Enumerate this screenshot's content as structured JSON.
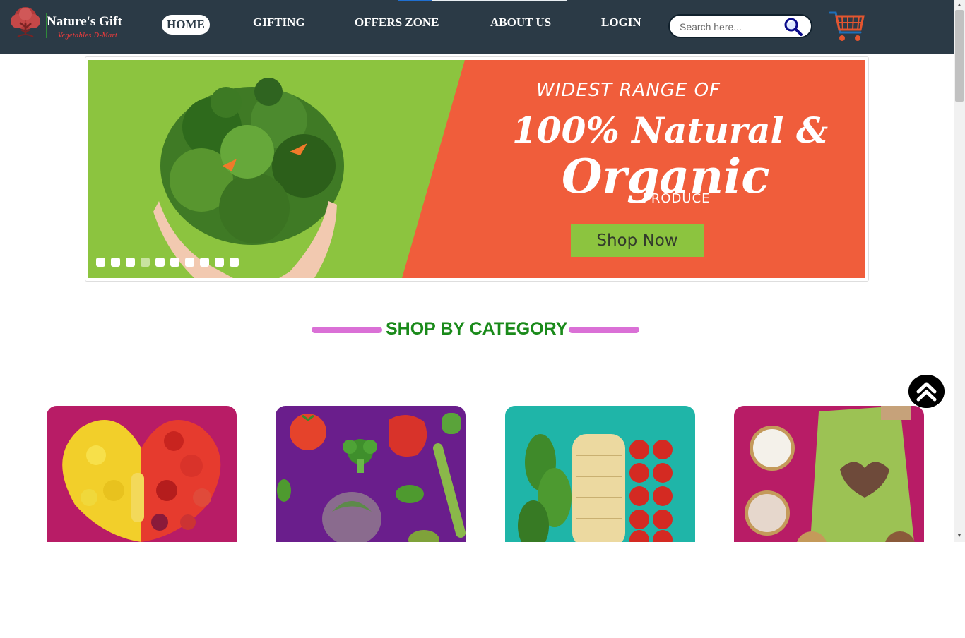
{
  "brand": {
    "name": "Nature's Gift",
    "tagline": "Vegetables D-Mart",
    "logo_icon": "tree-icon"
  },
  "nav": {
    "items": [
      {
        "label": "HOME",
        "active": true
      },
      {
        "label": "GIFTING",
        "active": false
      },
      {
        "label": "OFFERS ZONE",
        "active": false
      },
      {
        "label": "ABOUT US",
        "active": false
      },
      {
        "label": "LOGIN",
        "active": false
      }
    ]
  },
  "search": {
    "placeholder": "Search here...",
    "value": "",
    "icon": "magnifier-icon"
  },
  "cart": {
    "icon": "shopping-cart-icon"
  },
  "banner": {
    "line1": "WIDEST RANGE OF",
    "line2": "100% Natural &",
    "line3": "Organic",
    "line4": "PRODUCE",
    "cta": "Shop Now",
    "slide_count": 10,
    "active_slide": 4
  },
  "section": {
    "title": "SHOP BY CATEGORY"
  },
  "back_to_top": {
    "icon": "double-chevron-up-icon"
  },
  "colors": {
    "header_bg": "#2b3a46",
    "banner_green": "#8cc43f",
    "banner_orange": "#f05d3b",
    "title_green": "#1a8a1a",
    "title_bar": "#da70d6",
    "card1_bg": "#b81c66",
    "card2_bg": "#6a1e8c",
    "card3_bg": "#1fb5a8",
    "card4_bg": "#b81c66"
  }
}
